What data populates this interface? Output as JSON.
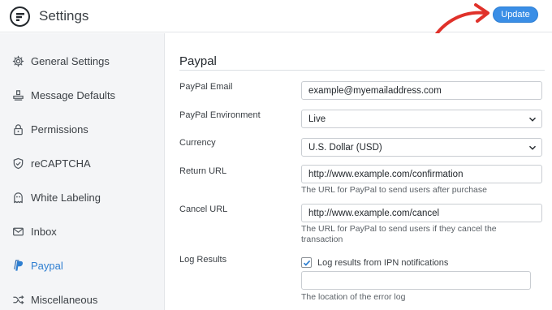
{
  "header": {
    "title": "Settings",
    "update_label": "Update",
    "accent_color": "#3a8ee6",
    "annotation_arrow_color": "#e0312a"
  },
  "sidebar": {
    "items": [
      {
        "label": "General Settings",
        "icon": "gear-icon"
      },
      {
        "label": "Message Defaults",
        "icon": "stamp-icon"
      },
      {
        "label": "Permissions",
        "icon": "lock-icon"
      },
      {
        "label": "reCAPTCHA",
        "icon": "shield-check-icon"
      },
      {
        "label": "White Labeling",
        "icon": "ghost-icon"
      },
      {
        "label": "Inbox",
        "icon": "envelope-icon"
      },
      {
        "label": "Paypal",
        "icon": "paypal-icon",
        "active": true
      },
      {
        "label": "Miscellaneous",
        "icon": "shuffle-icon"
      }
    ]
  },
  "paypal": {
    "title": "Paypal",
    "email": {
      "label": "PayPal Email",
      "value": "example@myemailaddress.com"
    },
    "environment": {
      "label": "PayPal Environment",
      "value": "Live"
    },
    "currency": {
      "label": "Currency",
      "value": "U.S. Dollar (USD)"
    },
    "return_url": {
      "label": "Return URL",
      "value": "http://www.example.com/confirmation",
      "help": "The URL for PayPal to send users after purchase"
    },
    "cancel_url": {
      "label": "Cancel URL",
      "value": "http://www.example.com/cancel",
      "help": "The URL for PayPal to send users if they cancel the transaction"
    },
    "log_results": {
      "label": "Log Results",
      "checkbox_label": "Log results from IPN notifications",
      "checked": true,
      "help": "The location of the error log",
      "value": ""
    }
  }
}
